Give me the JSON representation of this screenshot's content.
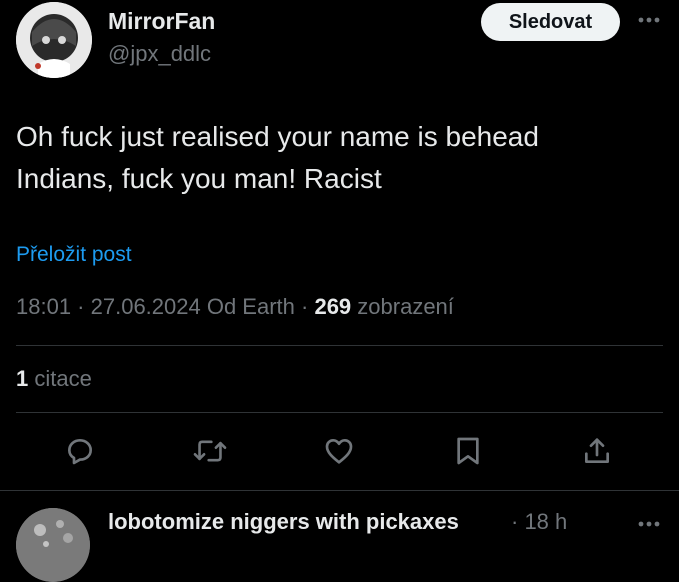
{
  "post": {
    "author": {
      "display_name": "MirrorFan",
      "handle": "@jpx_ddlc"
    },
    "follow_label": "Sledovat",
    "text": "Oh fuck just realised your name is behead\nIndians, fuck you man! Racist",
    "translate_label": "Přeložit post",
    "meta": {
      "time": "18:01",
      "sep1": " · ",
      "date": "27.06.2024",
      "source": " Od Earth",
      "sep2": " · ",
      "views_count": "269",
      "views_label": " zobrazení"
    },
    "quotes": {
      "count": "1",
      "label": " citace"
    },
    "actions": [
      {
        "icon": "reply-icon"
      },
      {
        "icon": "repost-icon"
      },
      {
        "icon": "like-icon"
      },
      {
        "icon": "bookmark-icon"
      },
      {
        "icon": "share-icon"
      }
    ]
  },
  "reply_preview": {
    "display_name": "lobotomize niggers with pickaxes",
    "time": "· 18 h"
  },
  "colors": {
    "background": "#000000",
    "text_primary": "#e7e9ea",
    "text_secondary": "#71767b",
    "accent": "#1d9bf0",
    "divider": "#2f3336",
    "follow_bg": "#eff3f4"
  }
}
